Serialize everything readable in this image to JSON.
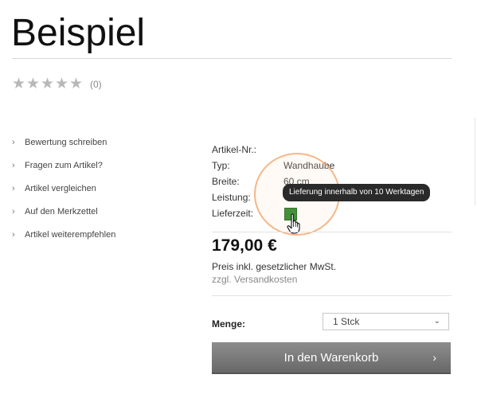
{
  "product": {
    "title": "Beispiel",
    "rating": {
      "stars_filled": 0,
      "stars_total": 5,
      "count_text": "(0)"
    }
  },
  "side_actions": [
    {
      "label": "Bewertung schreiben"
    },
    {
      "label": "Fragen zum Artikel?"
    },
    {
      "label": "Artikel vergleichen"
    },
    {
      "label": "Auf den Merkzettel"
    },
    {
      "label": "Artikel weiterempfehlen"
    }
  ],
  "specs": {
    "article_no_label": "Artikel-Nr.:",
    "article_no_value": "",
    "type_label": "Typ:",
    "type_value": "Wandhaube",
    "width_label": "Breite:",
    "width_value": "60 cm",
    "power_label": "Leistung:",
    "power_value": "",
    "delivery_label": "Lieferzeit:",
    "delivery_status_color": "#1a7f1a"
  },
  "tooltip": {
    "text": "Lieferung innerhalb von 10 Werktagen"
  },
  "pricing": {
    "price": "179,00 €",
    "tax_note": "Preis inkl. gesetzlicher MwSt.",
    "shipping_note": "zzgl. Versandkosten"
  },
  "quantity": {
    "label": "Menge:",
    "selected": "1 Stck"
  },
  "cart": {
    "button_label": "In den Warenkorb"
  },
  "colors": {
    "cart_button": "#7a7a7a",
    "availability": "#1a7f1a",
    "tooltip_bg": "#2a2a2a",
    "highlight_ring": "#f0a064"
  }
}
